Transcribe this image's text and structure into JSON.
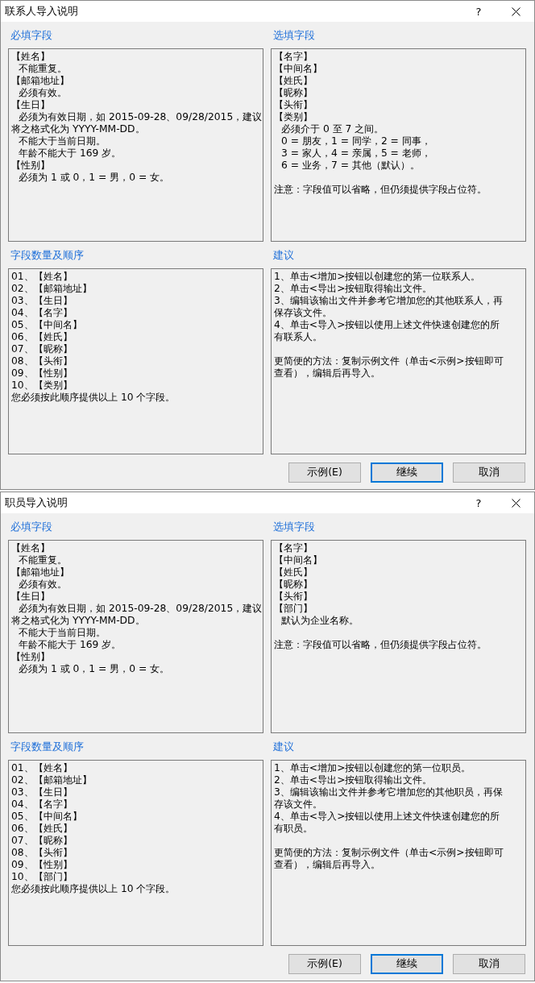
{
  "dialogs": [
    {
      "title": "联系人导入说明",
      "help": "?",
      "sections": [
        {
          "heading": "必填字段",
          "lines": [
            {
              "kind": "plain",
              "text": "【姓名】"
            },
            {
              "kind": "indented",
              "text": "不能重复。"
            },
            {
              "kind": "plain",
              "text": "【邮箱地址】"
            },
            {
              "kind": "indented",
              "text": "必须有效。"
            },
            {
              "kind": "plain",
              "text": "【生日】"
            },
            {
              "kind": "indented",
              "text": "必须为有效日期，如 2015-09-28、09/28/2015，建议"
            },
            {
              "kind": "plain",
              "text": "将之格式化为 YYYY-MM-DD。"
            },
            {
              "kind": "indented",
              "text": "不能大于当前日期。"
            },
            {
              "kind": "indented",
              "text": "年龄不能大于 169 岁。"
            },
            {
              "kind": "plain",
              "text": "【性别】"
            },
            {
              "kind": "indented",
              "text": "必须为 1 或 0，1 = 男，0 = 女。"
            }
          ]
        },
        {
          "heading": "选填字段",
          "lines": [
            {
              "kind": "plain",
              "text": "【名字】"
            },
            {
              "kind": "plain",
              "text": "【中间名】"
            },
            {
              "kind": "plain",
              "text": "【姓氏】"
            },
            {
              "kind": "plain",
              "text": "【昵称】"
            },
            {
              "kind": "plain",
              "text": "【头衔】"
            },
            {
              "kind": "plain",
              "text": "【类别】"
            },
            {
              "kind": "indented",
              "text": "必须介于 0 至 7 之间。"
            },
            {
              "kind": "indented",
              "text": "0 = 朋友，1 = 同学，2 = 同事，"
            },
            {
              "kind": "indented",
              "text": "3 = 家人，4 = 亲属，5 = 老师，"
            },
            {
              "kind": "indented",
              "text": "6 = 业务，7 = 其他（默认）。"
            },
            {
              "kind": "gap"
            },
            {
              "kind": "plain",
              "text": "注意：字段值可以省略，但仍须提供字段占位符。"
            }
          ]
        },
        {
          "heading": "字段数量及顺序",
          "lines": [
            {
              "kind": "plain",
              "text": "01、【姓名】"
            },
            {
              "kind": "plain",
              "text": "02、【邮箱地址】"
            },
            {
              "kind": "plain",
              "text": "03、【生日】"
            },
            {
              "kind": "plain",
              "text": "04、【名字】"
            },
            {
              "kind": "plain",
              "text": "05、【中间名】"
            },
            {
              "kind": "plain",
              "text": "06、【姓氏】"
            },
            {
              "kind": "plain",
              "text": "07、【昵称】"
            },
            {
              "kind": "plain",
              "text": "08、【头衔】"
            },
            {
              "kind": "plain",
              "text": "09、【性别】"
            },
            {
              "kind": "plain",
              "text": "10、【类别】"
            },
            {
              "kind": "plain",
              "text": "您必须按此顺序提供以上 10 个字段。"
            }
          ]
        },
        {
          "heading": "建议",
          "lines": [
            {
              "kind": "plain",
              "text": "1、单击<增加>按钮以创建您的第一位联系人。"
            },
            {
              "kind": "plain",
              "text": "2、单击<导出>按钮取得输出文件。"
            },
            {
              "kind": "plain",
              "text": "3、编辑该输出文件并参考它增加您的其他联系人，再"
            },
            {
              "kind": "plain",
              "text": "保存该文件。"
            },
            {
              "kind": "plain",
              "text": "4、单击<导入>按钮以使用上述文件快速创建您的所"
            },
            {
              "kind": "plain",
              "text": "有联系人。"
            },
            {
              "kind": "gap"
            },
            {
              "kind": "plain",
              "text": "更简便的方法：复制示例文件（单击<示例>按钮即可"
            },
            {
              "kind": "plain",
              "text": "查看），编辑后再导入。"
            }
          ]
        }
      ],
      "buttons": [
        {
          "label": "示例(E)",
          "default": false
        },
        {
          "label": "继续",
          "default": true
        },
        {
          "label": "取消",
          "default": false
        }
      ]
    },
    {
      "title": "职员导入说明",
      "help": "?",
      "sections": [
        {
          "heading": "必填字段",
          "lines": [
            {
              "kind": "plain",
              "text": "【姓名】"
            },
            {
              "kind": "indented",
              "text": "不能重复。"
            },
            {
              "kind": "plain",
              "text": "【邮箱地址】"
            },
            {
              "kind": "indented",
              "text": "必须有效。"
            },
            {
              "kind": "plain",
              "text": "【生日】"
            },
            {
              "kind": "indented",
              "text": "必须为有效日期，如 2015-09-28、09/28/2015，建议"
            },
            {
              "kind": "plain",
              "text": "将之格式化为 YYYY-MM-DD。"
            },
            {
              "kind": "indented",
              "text": "不能大于当前日期。"
            },
            {
              "kind": "indented",
              "text": "年龄不能大于 169 岁。"
            },
            {
              "kind": "plain",
              "text": "【性别】"
            },
            {
              "kind": "indented",
              "text": "必须为 1 或 0，1 = 男，0 = 女。"
            }
          ]
        },
        {
          "heading": "选填字段",
          "lines": [
            {
              "kind": "plain",
              "text": "【名字】"
            },
            {
              "kind": "plain",
              "text": "【中间名】"
            },
            {
              "kind": "plain",
              "text": "【姓氏】"
            },
            {
              "kind": "plain",
              "text": "【昵称】"
            },
            {
              "kind": "plain",
              "text": "【头衔】"
            },
            {
              "kind": "plain",
              "text": "【部门】"
            },
            {
              "kind": "indented",
              "text": "默认为企业名称。"
            },
            {
              "kind": "gap"
            },
            {
              "kind": "plain",
              "text": "注意：字段值可以省略，但仍须提供字段占位符。"
            }
          ]
        },
        {
          "heading": "字段数量及顺序",
          "lines": [
            {
              "kind": "plain",
              "text": "01、【姓名】"
            },
            {
              "kind": "plain",
              "text": "02、【邮箱地址】"
            },
            {
              "kind": "plain",
              "text": "03、【生日】"
            },
            {
              "kind": "plain",
              "text": "04、【名字】"
            },
            {
              "kind": "plain",
              "text": "05、【中间名】"
            },
            {
              "kind": "plain",
              "text": "06、【姓氏】"
            },
            {
              "kind": "plain",
              "text": "07、【昵称】"
            },
            {
              "kind": "plain",
              "text": "08、【头衔】"
            },
            {
              "kind": "plain",
              "text": "09、【性别】"
            },
            {
              "kind": "plain",
              "text": "10、【部门】"
            },
            {
              "kind": "plain",
              "text": "您必须按此顺序提供以上 10 个字段。"
            }
          ]
        },
        {
          "heading": "建议",
          "lines": [
            {
              "kind": "plain",
              "text": "1、单击<增加>按钮以创建您的第一位职员。"
            },
            {
              "kind": "plain",
              "text": "2、单击<导出>按钮取得输出文件。"
            },
            {
              "kind": "plain",
              "text": "3、编辑该输出文件并参考它增加您的其他职员，再保"
            },
            {
              "kind": "plain",
              "text": "存该文件。"
            },
            {
              "kind": "plain",
              "text": "4、单击<导入>按钮以使用上述文件快速创建您的所"
            },
            {
              "kind": "plain",
              "text": "有职员。"
            },
            {
              "kind": "gap"
            },
            {
              "kind": "plain",
              "text": "更简便的方法：复制示例文件（单击<示例>按钮即可"
            },
            {
              "kind": "plain",
              "text": "查看），编辑后再导入。"
            }
          ]
        }
      ],
      "buttons": [
        {
          "label": "示例(E)",
          "default": false
        },
        {
          "label": "继续",
          "default": true
        },
        {
          "label": "取消",
          "default": false
        }
      ]
    }
  ]
}
